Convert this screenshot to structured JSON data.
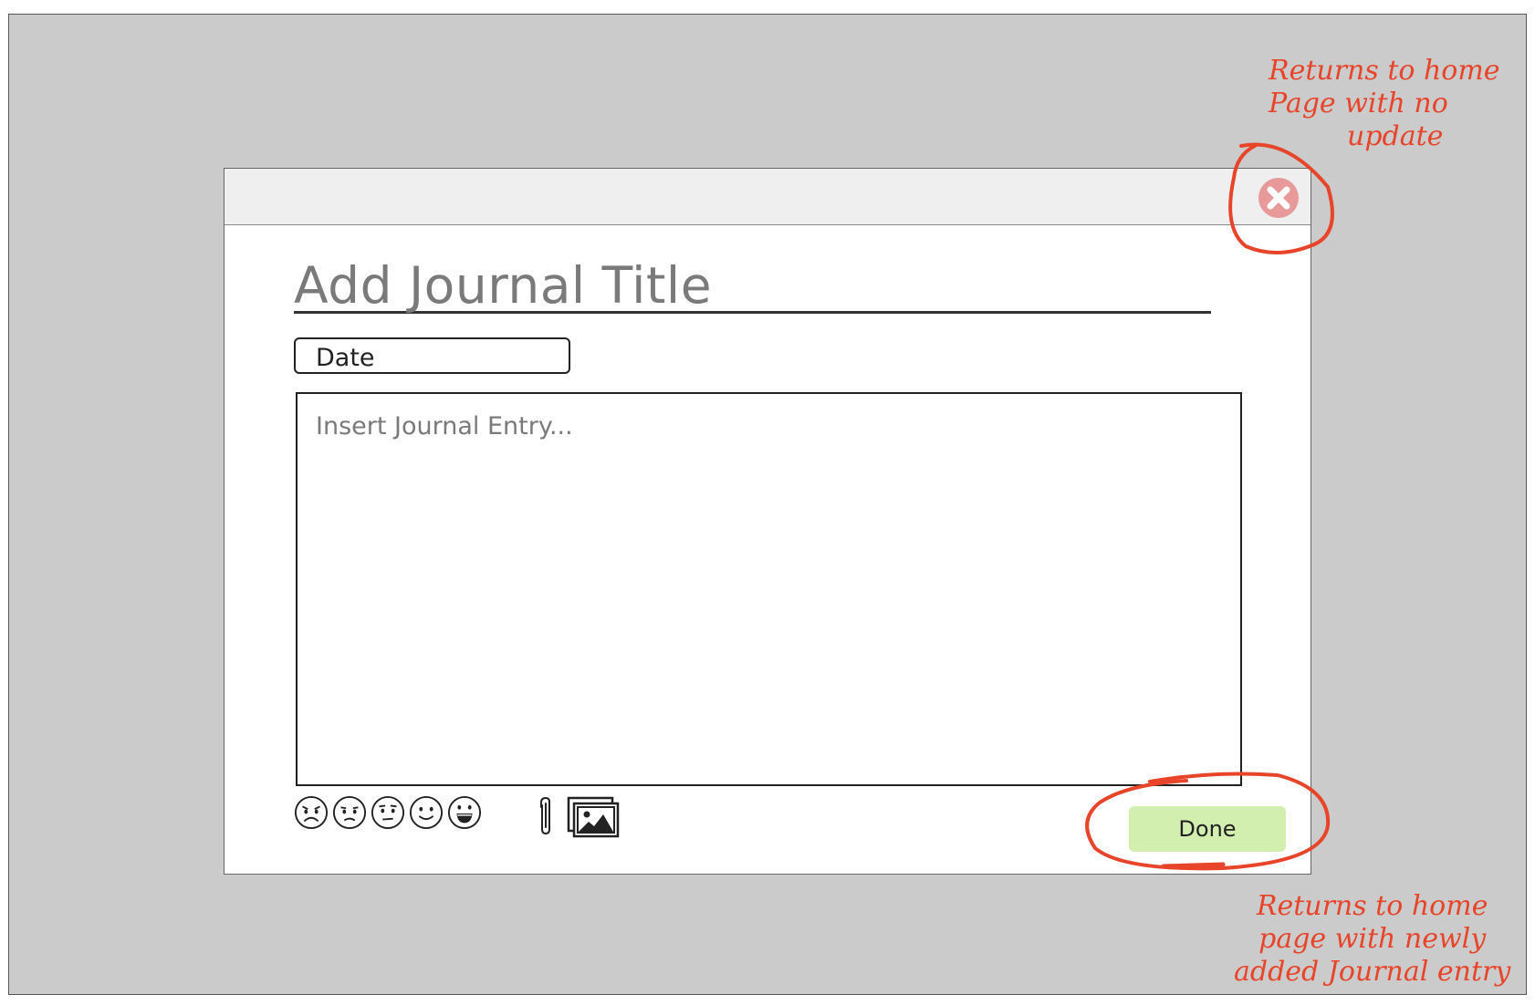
{
  "modal": {
    "title_placeholder": "Add Journal Title",
    "date_label": "Date",
    "entry_placeholder": "Insert Journal Entry...",
    "done_label": "Done",
    "close_icon": "close-circle-icon",
    "moods": [
      {
        "name": "very-sad-face-icon"
      },
      {
        "name": "sad-face-icon"
      },
      {
        "name": "neutral-face-icon"
      },
      {
        "name": "smile-face-icon"
      },
      {
        "name": "grin-face-icon"
      }
    ],
    "attach_icon": "paperclip-icon",
    "gallery_icon": "image-gallery-icon"
  },
  "annotations": {
    "close_note": [
      "Returns to home",
      "Page with no",
      "update"
    ],
    "done_note": [
      "Returns to home",
      "page with newly",
      "added Journal entry"
    ]
  },
  "colors": {
    "backdrop": "#cbcbcb",
    "annotation": "#e8442a",
    "done_button": "#d3efb0",
    "close_icon": "#e89a9a"
  }
}
